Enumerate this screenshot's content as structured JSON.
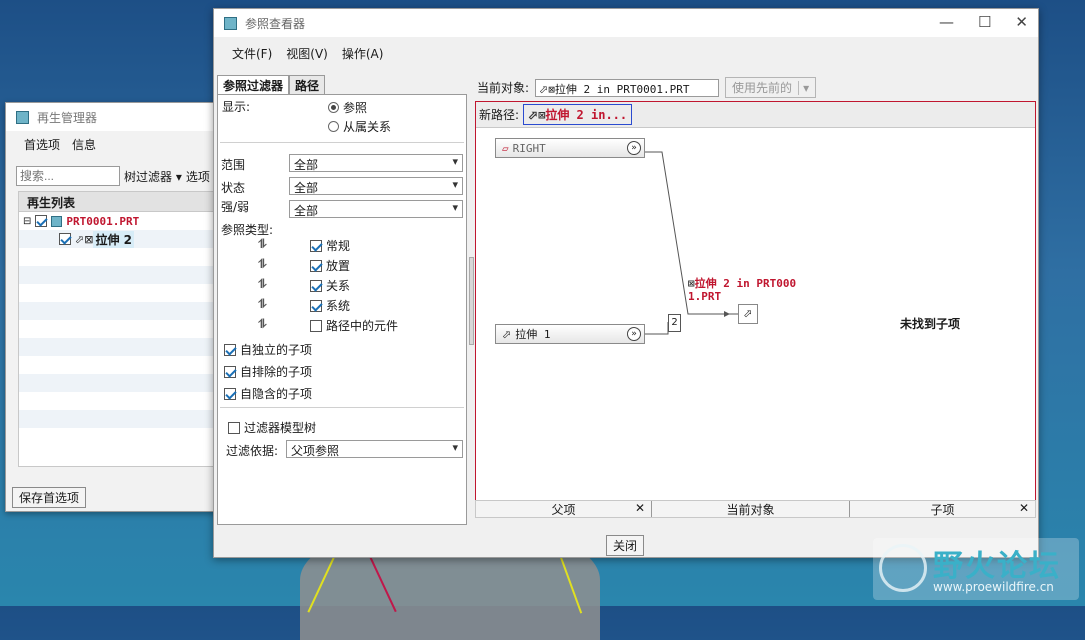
{
  "regen": {
    "title": "再生管理器",
    "menu": [
      "首选项",
      "信息"
    ],
    "search_placeholder": "搜索...",
    "tree_filter": "树过滤器",
    "options": "选项",
    "list_header": "再生列表",
    "items": [
      "PRT0001.PRT",
      "拉伸 2"
    ],
    "save_button": "保存首选项"
  },
  "main": {
    "title": "参照查看器",
    "menu": [
      "文件(F)",
      "视图(V)",
      "操作(A)"
    ],
    "tabs": [
      "参照过滤器",
      "路径"
    ],
    "display_label": "显示:",
    "display_options": [
      "参照",
      "从属关系"
    ],
    "range_label": "范围",
    "range_value": "全部",
    "state_label": "状态",
    "state_value": "全部",
    "strength_label": "强/弱",
    "strength_value": "全部",
    "ref_type_label": "参照类型:",
    "ref_types": [
      "常规",
      "放置",
      "关系",
      "系统",
      "路径中的元件"
    ],
    "self_options": [
      "自独立的子项",
      "自排除的子项",
      "自隐含的子项"
    ],
    "filter_model_tree": "过滤器模型树",
    "filter_by_label": "过滤依据:",
    "filter_by_value": "父项参照",
    "current_object_label": "当前对象:",
    "current_object_value": "拉伸 2 in PRT0001.PRT",
    "use_previous": "使用先前的",
    "new_path_label": "新路径:",
    "new_path_value": "拉伸 2 in...",
    "node_right": "RIGHT",
    "node_extrude1": "拉伸 1",
    "count_badge": "2",
    "current_node_label_1": "拉伸 2 in PRT000",
    "current_node_label_2": "1.PRT",
    "no_children": "未找到子项",
    "bottom_tabs": [
      "父项",
      "当前对象",
      "子项"
    ],
    "close_button": "关闭"
  },
  "watermark": {
    "title": "野火论坛",
    "url": "www.proewildfire.cn"
  }
}
